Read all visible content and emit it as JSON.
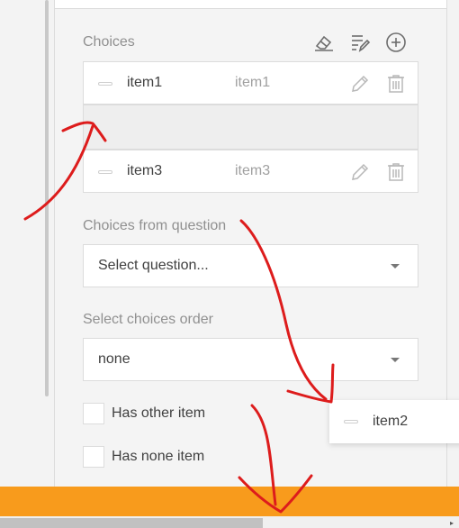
{
  "choices_section": {
    "label": "Choices",
    "toolbar": {
      "clear_icon": "eraser-icon",
      "edit_all_icon": "list-edit-icon",
      "add_icon": "plus-circle-icon"
    },
    "items": [
      {
        "text": "item1",
        "value": "item1"
      },
      {
        "text": "item3",
        "value": "item3"
      }
    ]
  },
  "dragged_item": {
    "text": "item2"
  },
  "choices_from_question": {
    "label": "Choices from question",
    "placeholder": "Select question..."
  },
  "choices_order": {
    "label": "Select choices order",
    "value": "none"
  },
  "checkboxes": [
    {
      "label": "Has other item",
      "checked": false
    },
    {
      "label": "Has none item",
      "checked": false
    }
  ],
  "colors": {
    "accent_bar": "#f89b1c",
    "annotation_red": "#dd1c1c"
  }
}
